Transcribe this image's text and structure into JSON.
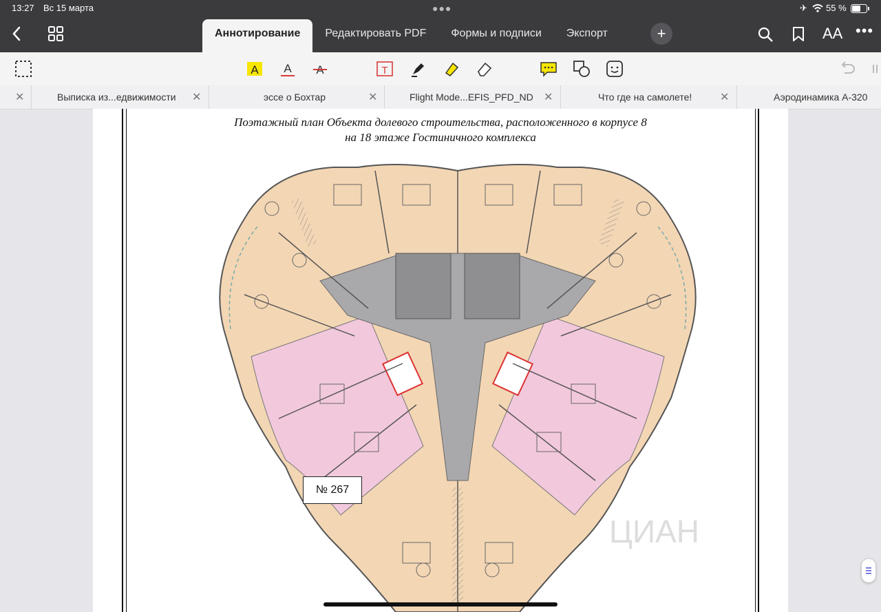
{
  "status": {
    "time": "13:27",
    "date": "Вс 15 марта",
    "battery": "55 %"
  },
  "tabs": [
    "Аннотирование",
    "Редактировать PDF",
    "Формы и подписи",
    "Экспорт"
  ],
  "active_tab": "Аннотирование",
  "icons": {
    "back": "chevron-left-icon",
    "grid": "grid-icon",
    "search": "search-icon",
    "bookmark": "bookmark-icon",
    "text_size": "text-size-icon",
    "more": "more-icon"
  },
  "text_size_label": "AA",
  "doc_tabs": [
    "Выписка из...едвижимости",
    "эссе о Бохтар",
    "Flight Mode...EFIS_PFD_ND",
    "Что где на самолете!",
    "Аэродинамика А-320"
  ],
  "document": {
    "title_line1": "Поэтажный план Объекта долевого строительства, расположенного в корпусе 8",
    "title_line2": "на 18 этаже Гостиничного комплекса",
    "unit_label": "№ 267",
    "watermark": "ЦИАН"
  },
  "colors": {
    "topbar": "#3b3b3e",
    "highlight_yellow": "#f7e600",
    "peach": "#f3d6b4",
    "pink": "#f2c8dc",
    "core_gray": "#a9a9ab"
  }
}
